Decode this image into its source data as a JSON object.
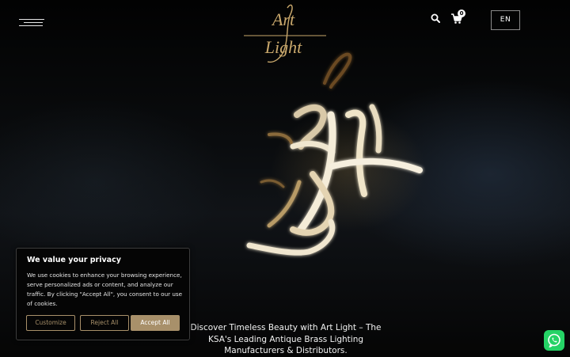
{
  "header": {
    "logo_text": "Art Light",
    "cart_count": "0",
    "language_label": "EN"
  },
  "hero": {
    "tagline": "Discover Timeless Beauty with Art Light – The KSA's Leading Antique Brass Lighting Manufacturers & Distributors."
  },
  "cookie_banner": {
    "title": "We value your privacy",
    "body": "We use cookies to enhance your browsing experience, serve personalized ads or content, and analyze our traffic. By clicking \"Accept All\", you consent to our use of cookies.",
    "customize_label": "Customize",
    "reject_label": "Reject All",
    "accept_label": "Accept All"
  },
  "icons": {
    "menu": "hamburger-menu-icon",
    "search": "search-icon",
    "cart": "cart-icon",
    "chat": "whatsapp-icon"
  },
  "colors": {
    "accent": "#a8906a",
    "logo_gold": "#c9a86c",
    "whatsapp": "#25d366"
  }
}
